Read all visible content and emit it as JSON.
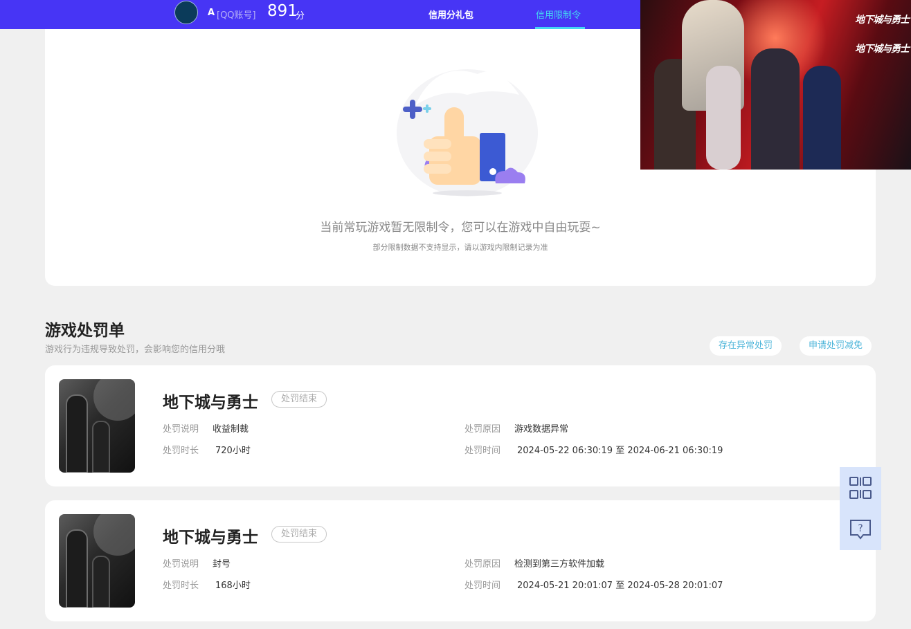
{
  "header": {
    "user_name": "A",
    "account_type": "[QQ账号]",
    "score": "891",
    "score_unit": "分",
    "tabs": [
      {
        "label": "信用分礼包"
      },
      {
        "label": "信用限制令"
      }
    ]
  },
  "banner": {
    "logo_text": "地下城与勇士"
  },
  "empty_state": {
    "title": "当前常玩游戏暂无限制令，您可以在游戏中自由玩耍~",
    "subtitle": "部分限制数据不支持显示，请以游戏内限制记录为准"
  },
  "penalty_section": {
    "title": "游戏处罚单",
    "subtitle": "游戏行为违规导致处罚，会影响您的信用分哦",
    "abnormal_button": "存在异常处罚",
    "reduce_button": "申请处罚减免",
    "items": [
      {
        "game": "地下城与勇士",
        "status": "处罚结束",
        "desc_label": "处罚说明",
        "desc_value": "收益制裁",
        "reason_label": "处罚原因",
        "reason_value": "游戏数据异常",
        "duration_label": "处罚时长",
        "duration_value": "720小时",
        "time_label": "处罚时间",
        "time_value": "2024-05-22 06:30:19 至 2024-06-21 06:30:19"
      },
      {
        "game": "地下城与勇士",
        "status": "处罚结束",
        "desc_label": "处罚说明",
        "desc_value": "封号",
        "reason_label": "处罚原因",
        "reason_value": "检测到第三方软件加载",
        "duration_label": "处罚时长",
        "duration_value": "168小时",
        "time_label": "处罚时间",
        "time_value": "2024-05-21 20:01:07 至 2024-05-28 20:01:07"
      }
    ]
  },
  "side_buttons": {
    "qr_icon": "qr-code-icon",
    "help_icon": "help-chat-icon"
  }
}
